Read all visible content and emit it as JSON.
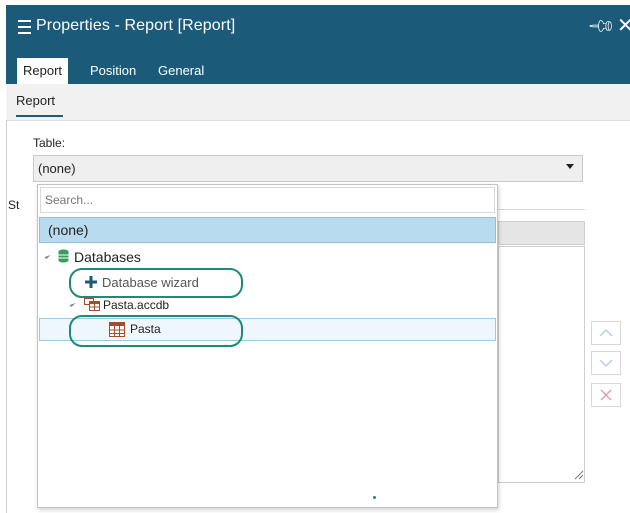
{
  "panel": {
    "title": "Properties - Report [Report]",
    "tabs": [
      {
        "label": "Report",
        "active": true
      },
      {
        "label": "Position",
        "active": false
      },
      {
        "label": "General",
        "active": false
      }
    ],
    "subtab": "Report"
  },
  "table_field": {
    "label": "Table:",
    "value": "(none)",
    "partial_label": "St"
  },
  "dropdown": {
    "search_placeholder": "Search...",
    "items": {
      "none": "(none)",
      "databases": "Databases",
      "database_wizard": "Database wizard",
      "pasta_accdb": "Pasta.accdb",
      "pasta": "Pasta"
    }
  },
  "colors": {
    "header": "#1c5a79",
    "selection": "#b9dbef",
    "annotation": "#1e8a78"
  },
  "icons": [
    "menu-icon",
    "pin-icon",
    "close-icon",
    "database-icon",
    "plus-icon",
    "access-file-icon",
    "table-icon"
  ]
}
